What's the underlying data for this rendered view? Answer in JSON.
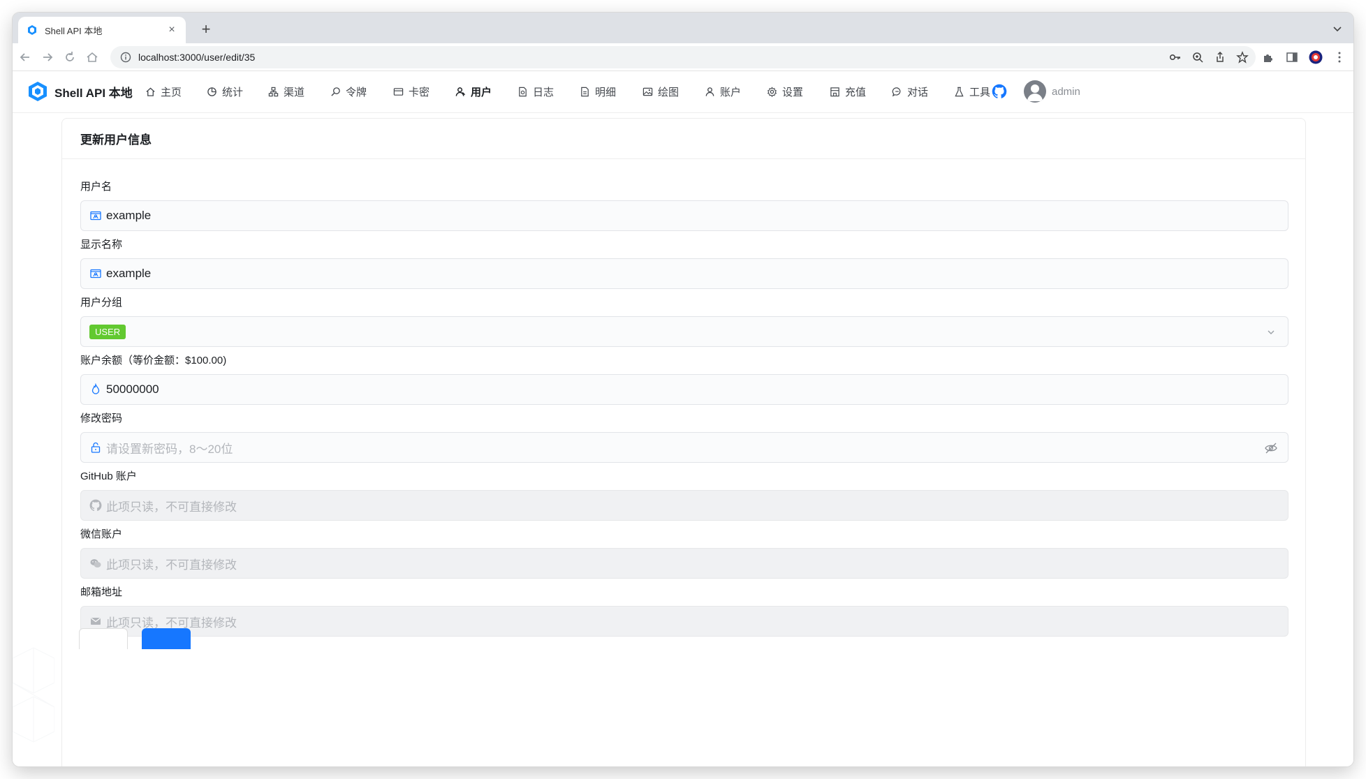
{
  "browser": {
    "tab_title": "Shell API 本地",
    "new_tab_label": "+",
    "url": "localhost:3000/user/edit/35"
  },
  "header": {
    "brand": "Shell API 本地",
    "nav": [
      {
        "label": "主页",
        "icon": "home-icon"
      },
      {
        "label": "统计",
        "icon": "pie-chart-icon"
      },
      {
        "label": "渠道",
        "icon": "channel-icon"
      },
      {
        "label": "令牌",
        "icon": "key-search-icon"
      },
      {
        "label": "卡密",
        "icon": "card-icon"
      },
      {
        "label": "用户",
        "icon": "user-icon",
        "active": true
      },
      {
        "label": "日志",
        "icon": "log-icon"
      },
      {
        "label": "明细",
        "icon": "detail-icon"
      },
      {
        "label": "绘图",
        "icon": "image-icon"
      },
      {
        "label": "账户",
        "icon": "account-icon"
      },
      {
        "label": "设置",
        "icon": "gear-icon"
      },
      {
        "label": "充值",
        "icon": "shop-icon"
      },
      {
        "label": "对话",
        "icon": "chat-icon"
      },
      {
        "label": "工具",
        "icon": "flask-icon"
      }
    ],
    "username": "admin"
  },
  "form": {
    "title": "更新用户信息",
    "username_label": "用户名",
    "username_value": "example",
    "display_name_label": "显示名称",
    "display_name_value": "example",
    "group_label": "用户分组",
    "group_value": "USER",
    "balance_label": "账户余额（等价金额：$100.00)",
    "balance_value": "50000000",
    "password_label": "修改密码",
    "password_placeholder": "请设置新密码，8～20位",
    "github_label": "GitHub 账户",
    "github_placeholder": "此项只读，不可直接修改",
    "wechat_label": "微信账户",
    "wechat_placeholder": "此项只读，不可直接修改",
    "email_label": "邮箱地址",
    "email_placeholder": "此项只读，不可直接修改"
  },
  "colors": {
    "accent": "#1677ff",
    "group_tag": "#52c41a"
  }
}
